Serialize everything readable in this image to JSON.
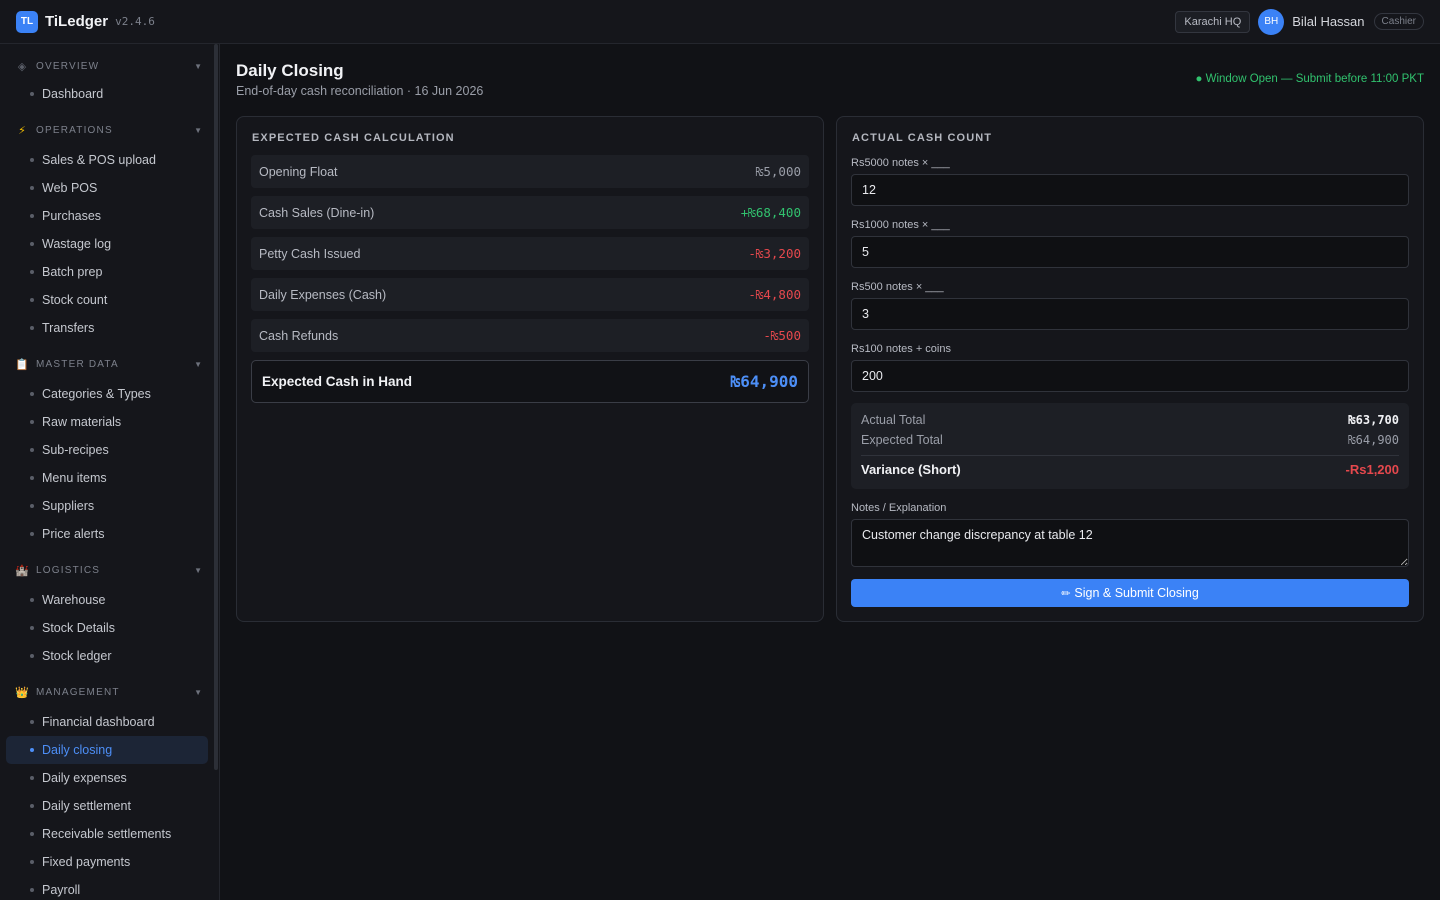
{
  "app": {
    "badge": "TL",
    "name": "TiLedger",
    "version": "v2.4.6"
  },
  "topbar": {
    "branch": "Karachi HQ",
    "user_initials": "BH",
    "user_name": "Bilal Hassan",
    "role": "Cashier"
  },
  "sidebar": {
    "sections": [
      {
        "title": "OVERVIEW",
        "icon": "diamond-icon",
        "items": [
          "Dashboard"
        ]
      },
      {
        "title": "OPERATIONS",
        "icon": "lightning-icon",
        "items": [
          "Sales & POS upload",
          "Web POS",
          "Purchases",
          "Wastage log",
          "Batch prep",
          "Stock count",
          "Transfers"
        ]
      },
      {
        "title": "MASTER DATA",
        "icon": "clipboard-icon",
        "items": [
          "Categories & Types",
          "Raw materials",
          "Sub-recipes",
          "Menu items",
          "Suppliers",
          "Price alerts"
        ]
      },
      {
        "title": "LOGISTICS",
        "icon": "castle-icon",
        "items": [
          "Warehouse",
          "Stock Details",
          "Stock ledger"
        ]
      },
      {
        "title": "MANAGEMENT",
        "icon": "crown-icon",
        "items": [
          "Financial dashboard",
          "Daily closing",
          "Daily expenses",
          "Daily settlement",
          "Receivable settlements",
          "Fixed payments",
          "Payroll"
        ]
      }
    ],
    "active_item": "Daily closing"
  },
  "page": {
    "title": "Daily Closing",
    "subtitle": "End-of-day cash reconciliation · 16 Jun 2026",
    "window_status": "● Window Open — Submit before 11:00 PKT"
  },
  "expected": {
    "title": "EXPECTED CASH CALCULATION",
    "rows": [
      {
        "label": "Opening Float",
        "value": "₨5,000",
        "kind": "neutral"
      },
      {
        "label": "Cash Sales (Dine-in)",
        "value": "+₨68,400",
        "kind": "pos"
      },
      {
        "label": "Petty Cash Issued",
        "value": "-₨3,200",
        "kind": "neg"
      },
      {
        "label": "Daily Expenses (Cash)",
        "value": "-₨4,800",
        "kind": "neg"
      },
      {
        "label": "Cash Refunds",
        "value": "-₨500",
        "kind": "neg"
      }
    ],
    "total_label": "Expected Cash in Hand",
    "total_value": "₨64,900"
  },
  "actual": {
    "title": "ACTUAL CASH COUNT",
    "fields": [
      {
        "label": "Rs5000 notes × ___",
        "value": "12"
      },
      {
        "label": "Rs1000 notes × ___",
        "value": "5"
      },
      {
        "label": "Rs500 notes × ___",
        "value": "3"
      },
      {
        "label": "Rs100 notes + coins",
        "value": "200"
      }
    ],
    "summary": {
      "actual_label": "Actual Total",
      "actual_value": "₨63,700",
      "expected_label": "Expected Total",
      "expected_value": "₨64,900",
      "variance_label": "Variance (Short)",
      "variance_value": "-Rs1,200"
    },
    "notes_label": "Notes / Explanation",
    "notes_value": "Customer change discrepancy at table 12",
    "submit_label": "Sign & Submit Closing"
  },
  "colors": {
    "accent": "#3b82f6",
    "positive": "#31c26e",
    "negative": "#e5484d",
    "background": "#111216"
  }
}
